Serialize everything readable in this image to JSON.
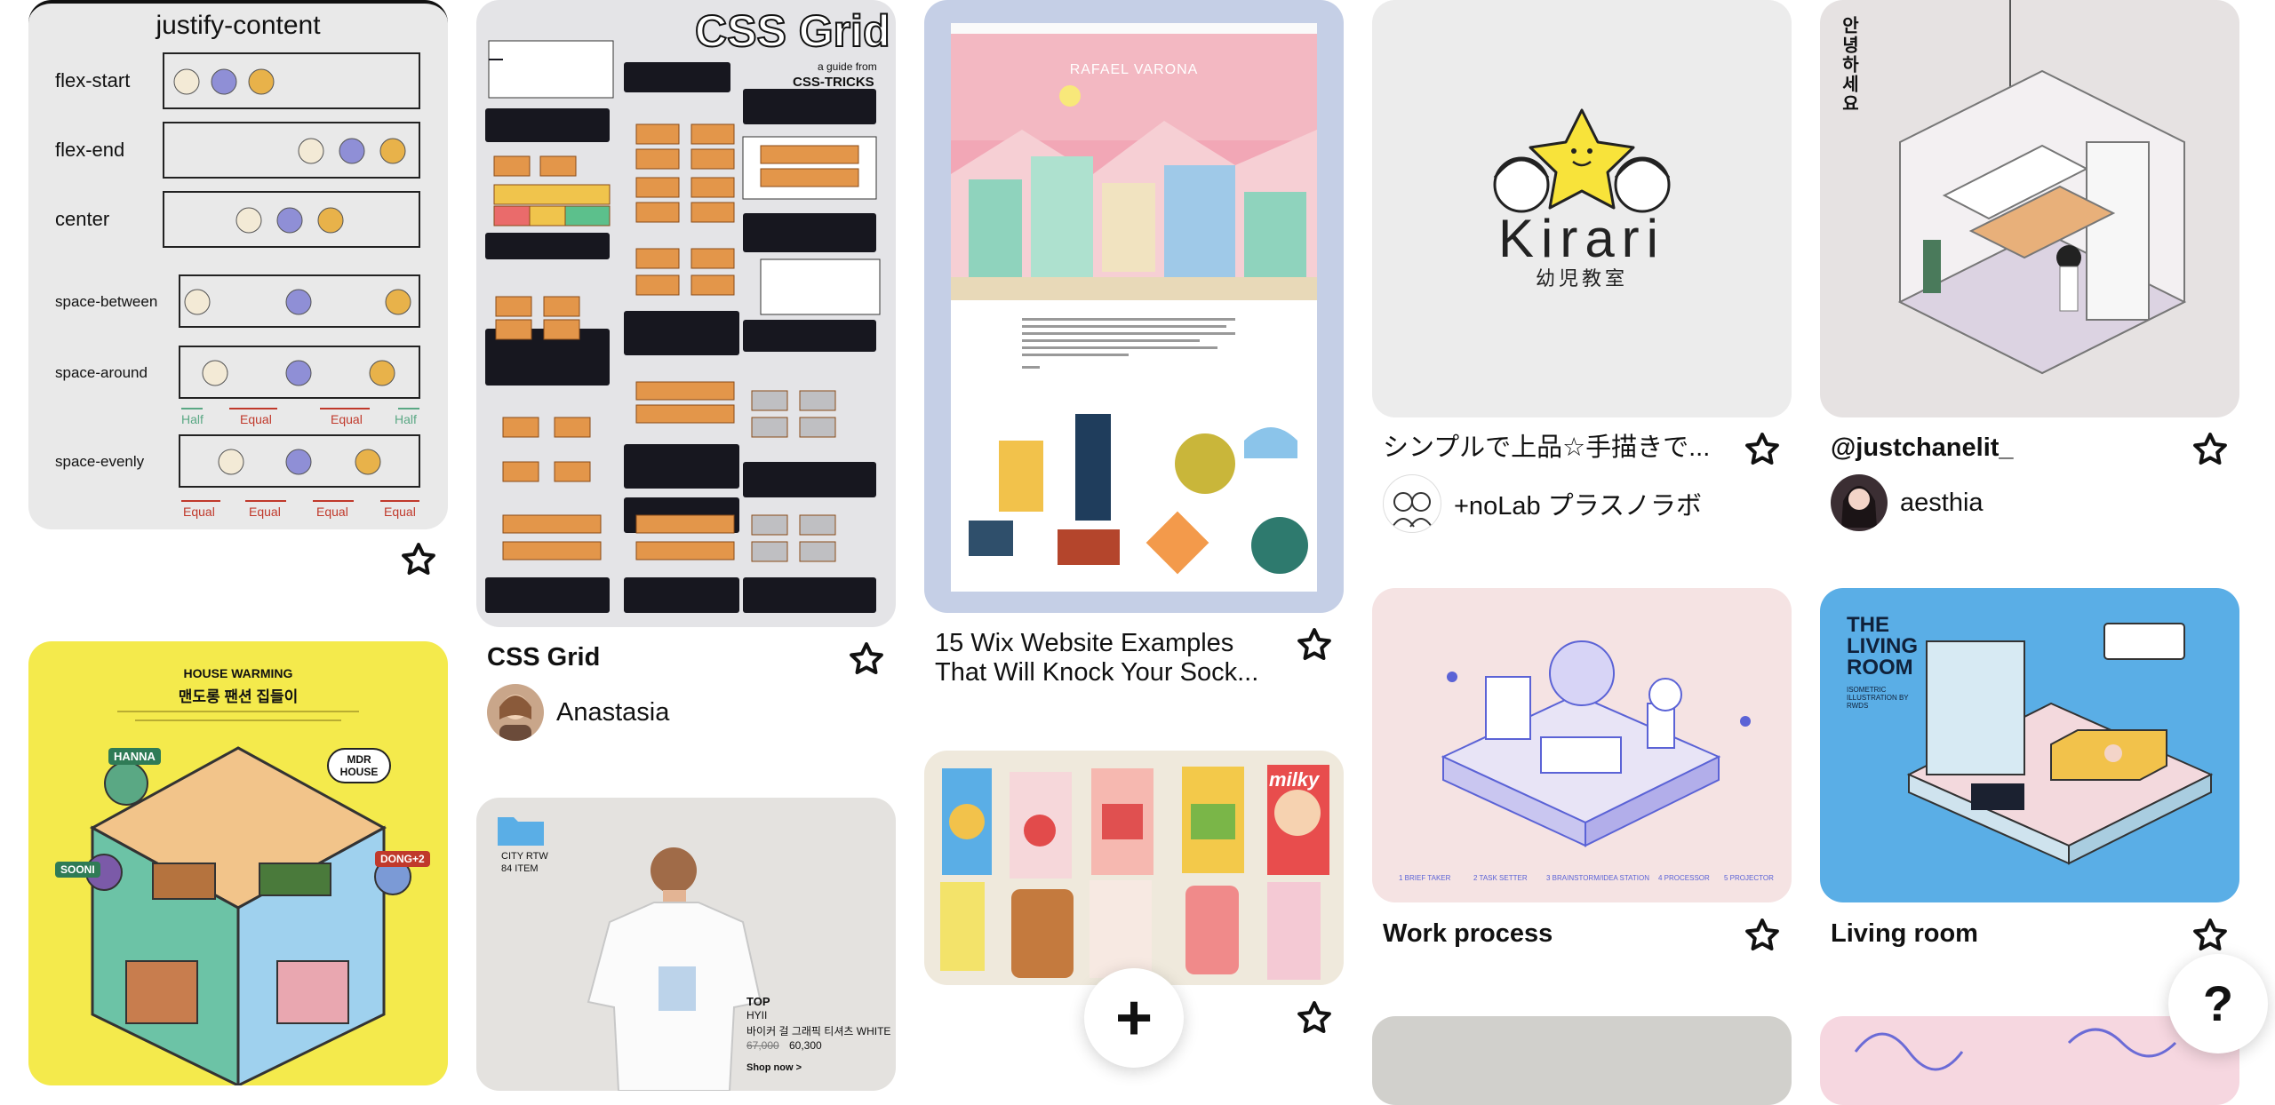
{
  "pins": {
    "justify": {
      "title": "justify-content",
      "rows": [
        "flex-start",
        "flex-end",
        "center",
        "space-between",
        "space-around",
        "space-evenly"
      ],
      "half": "Half",
      "equal": "Equal"
    },
    "css_grid": {
      "heading": "CSS Grid",
      "guide": "a guide from",
      "brand": "CSS-TRICKS",
      "title": "CSS Grid",
      "author": "Anastasia"
    },
    "wix": {
      "site_name": "RAFAEL VARONA",
      "title_line1": "15 Wix Website Examples",
      "title_line2": "That Will Knock Your Sock..."
    },
    "kirari": {
      "logo": "Kirari",
      "logo_sub": "幼児教室",
      "title": "シンプルで上品☆手描きで...",
      "author": "+noLab プラスノラボ"
    },
    "kitchen": {
      "vertical_text": "안녕하세요",
      "title": "@justchanelit_",
      "author": "aesthia"
    },
    "house": {
      "heading": "HOUSE WARMING",
      "subheading": "맨도롱 팬션 집들이",
      "tag1": "HANNA",
      "tag2": "MDR HOUSE",
      "tag3": "SOONI",
      "tag4": "DONG+2"
    },
    "workproc": {
      "title": "Work process",
      "steps": [
        "1 BRIEF TAKER",
        "2 TASK SETTER",
        "3 BRAINSTORM/IDEA STATION",
        "4 PROCESSOR",
        "5 PROJECTOR"
      ]
    },
    "livingroom": {
      "heading_line1": "THE",
      "heading_line2": "LIVING",
      "heading_line3": "ROOM",
      "sub": "ISOMETRIC ILLUSTRATION BY RWDS",
      "title": "Living room"
    },
    "fashion": {
      "folder": "CITY RTW",
      "items": "84 ITEM",
      "top": "TOP",
      "brand": "HYII",
      "product": "바이커 걸 그래픽 티셔츠 WHITE",
      "old_price": "67,000",
      "price": "60,300",
      "shop": "Shop now >"
    },
    "drinks": {
      "label": "milky"
    }
  },
  "fab": {
    "add": "+",
    "help": "?"
  },
  "colors": {
    "text": "#111111",
    "yellow": "#f4ea4c",
    "blue": "#5aaee6",
    "pinkbg": "#f5e3e3",
    "grey": "#e8e8e8"
  }
}
